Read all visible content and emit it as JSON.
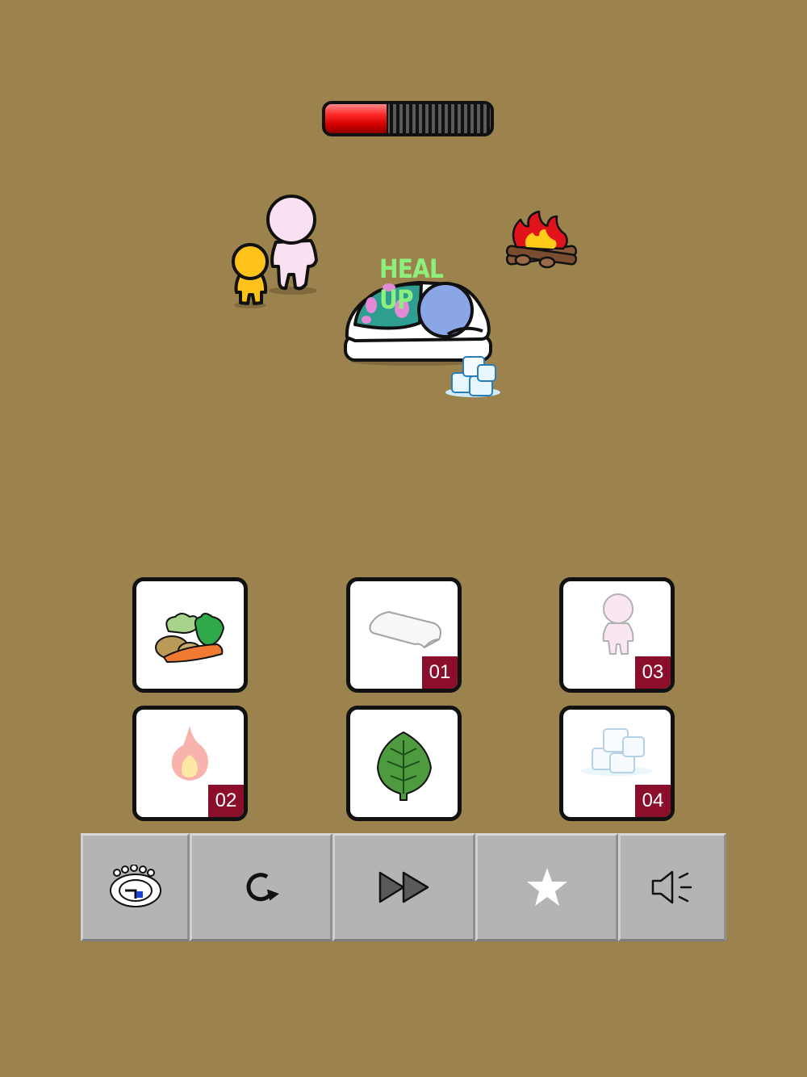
{
  "hud": {
    "health_fill_fraction": 0.37,
    "status_text": "HEAL UP"
  },
  "items": [
    {
      "name": "vegetables",
      "badge": ""
    },
    {
      "name": "towel",
      "badge": "01"
    },
    {
      "name": "person",
      "badge": "03"
    },
    {
      "name": "fire",
      "badge": "02"
    },
    {
      "name": "leaf",
      "badge": ""
    },
    {
      "name": "ice",
      "badge": "04"
    }
  ],
  "toolbar": {
    "buttons": [
      "logo-icon",
      "restart-icon",
      "fast-forward-icon",
      "star-icon",
      "sound-icon"
    ]
  },
  "colors": {
    "background": "#9c834e",
    "badge": "#8b0f2a",
    "heal_text": "#8cf07c",
    "health_red": "#ff2a2a"
  }
}
